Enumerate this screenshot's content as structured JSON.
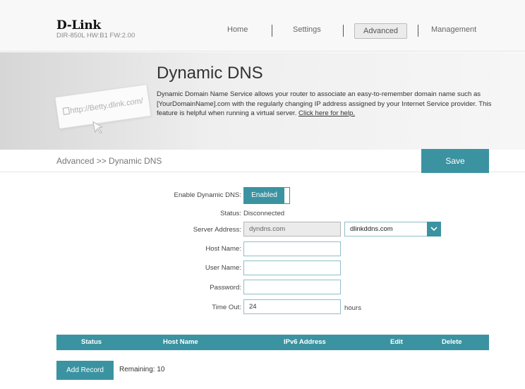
{
  "header": {
    "brand": "D-Link",
    "model_info": "DIR-850L   HW:B1   FW:2.00",
    "nav": {
      "home": "Home",
      "settings": "Settings",
      "advanced": "Advanced",
      "management": "Management"
    }
  },
  "banner": {
    "url_illustration": "http://Betty.dlink.com/",
    "title": "Dynamic DNS",
    "description": "Dynamic Domain Name Service allows your router to associate an easy-to-remember domain name such as [YourDomainName].com with the regularly changing IP address assigned by your Internet Service provider. This feature is helpful when running a virtual server. ",
    "help_link": "Click here for help."
  },
  "breadcrumb": "Advanced >> Dynamic DNS",
  "save_label": "Save",
  "form": {
    "enable_label": "Enable Dynamic DNS:",
    "enable_value": "Enabled",
    "status_label": "Status:",
    "status_value": "Disconnected",
    "server_label": "Server Address:",
    "server_value": "dyndns.com",
    "server_select": "dlinkddns.com",
    "host_label": "Host Name:",
    "host_value": "",
    "user_label": "User Name:",
    "user_value": "",
    "password_label": "Password:",
    "password_value": "",
    "timeout_label": "Time Out:",
    "timeout_value": "24",
    "timeout_unit": "hours"
  },
  "table": {
    "headers": [
      "Status",
      "Host Name",
      "IPv6 Address",
      "Edit",
      "Delete"
    ]
  },
  "add_record_label": "Add Record",
  "remaining": "Remaining: 10",
  "colors": {
    "accent": "#3b93a1"
  }
}
